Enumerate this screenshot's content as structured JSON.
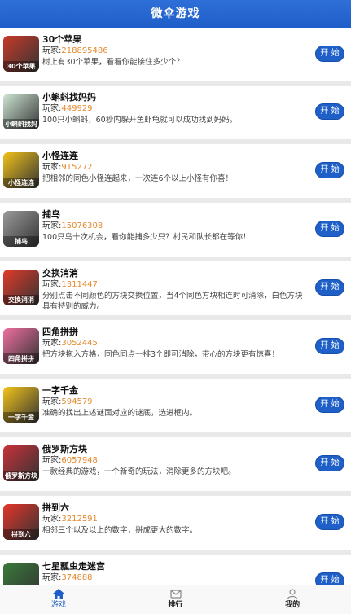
{
  "header": {
    "title": "微伞游戏"
  },
  "play_prefix": "玩家:",
  "start_label": "开 始",
  "games": [
    {
      "name": "30个苹果",
      "plays": "218895486",
      "desc": "树上有30个苹果，看看你能接住多少个？",
      "icon": "apples-icon",
      "caption": "30个苹果",
      "color": "#c83a2a"
    },
    {
      "name": "小蝌蚪找妈妈",
      "plays": "449929",
      "desc": "100只小蝌蚪，60秒内躲开鱼虾龟就可以成功找到妈妈。",
      "icon": "tadpole-icon",
      "caption": "小蝌蚪找妈妈",
      "color": "#cfe6d4"
    },
    {
      "name": "小怪连连",
      "plays": "915272",
      "desc": "把相邻的同色小怪连起来，一次连6个以上小怪有你喜！",
      "icon": "monster-icon",
      "caption": "小怪连连",
      "color": "#f2c21a"
    },
    {
      "name": "捕鸟",
      "plays": "15076308",
      "desc": "100只鸟十次机会，看你能捕多少只？村民和队长都在等你！",
      "icon": "bird-icon",
      "caption": "捕鸟",
      "color": "#9a9a9a"
    },
    {
      "name": "交换消消",
      "plays": "1311447",
      "desc": "分别点击不同颜色的方块交换位置，当4个同色方块相连时可消除，白色方块具有特别的威力。",
      "icon": "swap-blocks-icon",
      "caption": "交换消消",
      "color": "#e33a2a"
    },
    {
      "name": "四角拼拼",
      "plays": "3052445",
      "desc": "把方块拖入方格，同色同点一排3个即可消除，带心的方块更有惊喜！",
      "icon": "heart-blocks-icon",
      "caption": "四角拼拼",
      "color": "#f06fa0"
    },
    {
      "name": "一字千金",
      "plays": "594579",
      "desc": "准确的找出上述谜面对应的谜底，选进框内。",
      "icon": "gold-ingot-icon",
      "caption": "一字千金",
      "color": "#f5c41a"
    },
    {
      "name": "俄罗斯方块",
      "plays": "6057948",
      "desc": "一款经典的游戏，一个新奇的玩法，消除更多的方块吧。",
      "icon": "tetris-icon",
      "caption": "俄罗斯方块",
      "color": "#c8323a"
    },
    {
      "name": "拼到六",
      "plays": "3212591",
      "desc": "相邻三个以及以上的数字，拼成更大的数字。",
      "icon": "number-six-icon",
      "caption": "拼到六",
      "color": "#e5352a"
    },
    {
      "name": "七星瓢虫走迷宫",
      "plays": "374888",
      "desc": "",
      "icon": "ladybug-icon",
      "caption": "",
      "color": "#3a7a3a"
    }
  ],
  "tabs": [
    {
      "label": "游戏",
      "icon": "home-icon"
    },
    {
      "label": "排行",
      "icon": "ranking-icon"
    },
    {
      "label": "我的",
      "icon": "user-icon"
    }
  ]
}
